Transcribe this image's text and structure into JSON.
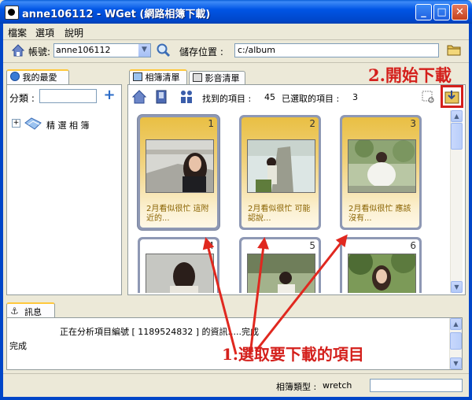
{
  "window": {
    "title": "anne106112 - WGet (網路相簿下載)"
  },
  "menu": [
    "檔案",
    "選項",
    "說明"
  ],
  "toolbar": {
    "account_label": "帳號:",
    "account_value": "anne106112",
    "save_label": "儲存位置 :",
    "save_path": "c:/album"
  },
  "left_panel": {
    "tab": "我的最愛",
    "category_label": "分類 :",
    "tree_item": "精 選 相 簿"
  },
  "main_panel": {
    "tabs": [
      "相簿清單",
      "影音清單"
    ],
    "found_label": "找到的項目 :",
    "found_count": "45",
    "selected_label": "已選取的項目 :",
    "selected_count": "3",
    "albums": [
      {
        "num": "1",
        "caption": "2月看似很忙 這附近的..."
      },
      {
        "num": "2",
        "caption": "2月看似很忙 可能認說..."
      },
      {
        "num": "3",
        "caption": "2月看似很忙 應該沒有..."
      },
      {
        "num": "4",
        "caption": ""
      },
      {
        "num": "5",
        "caption": ""
      },
      {
        "num": "6",
        "caption": ""
      }
    ]
  },
  "log": {
    "title": "訊息",
    "line1": "正在分析項目編號 [ 1189524832 ] 的資訊.....完成",
    "line2": "完成"
  },
  "status": {
    "album_type_label": "相簿類型 :",
    "album_type_value": "wretch"
  },
  "annotations": {
    "start_download": "2.開始下載",
    "select_items": "1.選取要下載的項目"
  },
  "colors": {
    "annotation": "#D4201C",
    "titlebar": "#0055E5",
    "card_gold": "#E9BF43"
  }
}
